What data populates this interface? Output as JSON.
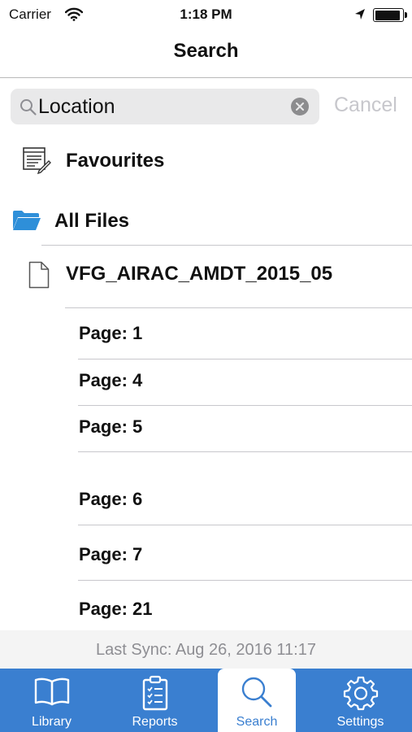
{
  "status_bar": {
    "carrier": "Carrier",
    "time": "1:18 PM",
    "battery_level": 0.92
  },
  "nav": {
    "title": "Search"
  },
  "search": {
    "value": "Location",
    "cancel_label": "Cancel"
  },
  "tree": {
    "favourites_label": "Favourites",
    "all_files_label": "All Files",
    "file_name": "VFG_AIRAC_AMDT_2015_05",
    "pages": [
      "Page: 1",
      "Page: 4",
      "Page: 5",
      "Page: 6",
      "Page: 7",
      "Page: 21"
    ]
  },
  "sync": {
    "text": "Last Sync: Aug 26, 2016 11:17"
  },
  "tabs": [
    {
      "label": "Library",
      "icon": "book-icon",
      "active": false
    },
    {
      "label": "Reports",
      "icon": "clipboard-checklist-icon",
      "active": false
    },
    {
      "label": "Search",
      "icon": "search-icon",
      "active": true
    },
    {
      "label": "Settings",
      "icon": "gear-icon",
      "active": false
    }
  ],
  "colors": {
    "accent": "#3a7fd0",
    "folder": "#2e8fd9",
    "cancel_disabled": "#c7c7cc"
  }
}
